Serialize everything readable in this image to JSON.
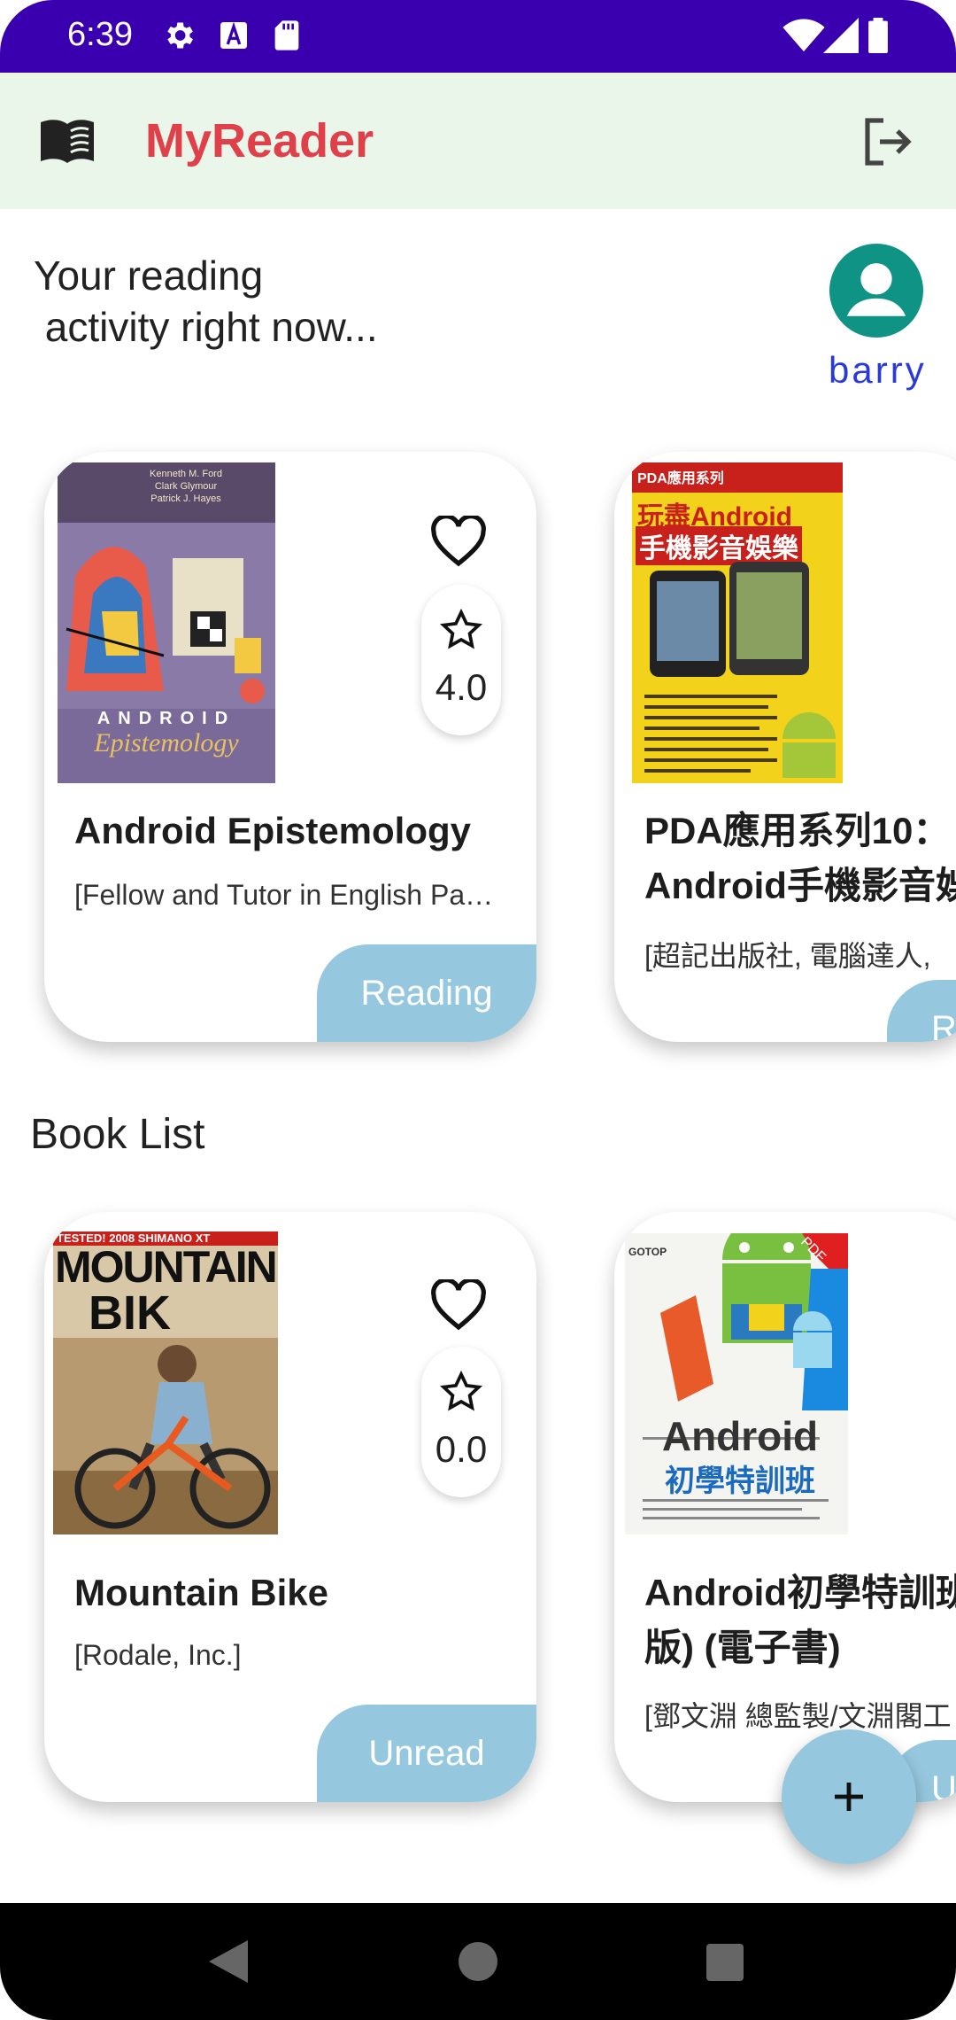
{
  "status_bar": {
    "time": "6:39"
  },
  "app_bar": {
    "title": "MyReader"
  },
  "header": {
    "headline": "Your reading\n activity right now...",
    "username": "barry"
  },
  "reading_cards": [
    {
      "title": "Android Epistemology",
      "publisher": "[Fellow and Tutor in English Pa…",
      "rating": "4.0",
      "status": "Reading",
      "cover": {
        "authors": "Kenneth M. Ford\nClark Glymour\nPatrick J. Hayes",
        "wordmark": "ANDROID",
        "subtitle": "Epistemology"
      }
    },
    {
      "title": "PDA應用系列10：\nAndroid手機影音娛",
      "publisher": "[超記出版社, 電腦達人,",
      "status": "R",
      "cover": {
        "series": "PDA應用系列",
        "line1": "玩盡Android",
        "line2": "手機影音娛樂"
      }
    }
  ],
  "book_list": {
    "title": "Book List",
    "cards": [
      {
        "title": "Mountain Bike",
        "publisher": "[Rodale, Inc.]",
        "rating": "0.0",
        "status": "Unread",
        "cover": {
          "banner": "TESTED! 2008 SHIMANO XT",
          "line1": "MOUNTAIN",
          "line2": "BIK"
        }
      },
      {
        "title": "Android初學特訓班\n版) (電子書)",
        "publisher": "[鄧文淵 總監製/文淵閣工",
        "status": "U",
        "cover": {
          "brand": "GOTOP",
          "badge": "PDF",
          "line1": "Android",
          "line2": "初學特訓班"
        }
      }
    ]
  },
  "colors": {
    "status_bar": "#3a00b0",
    "app_bar": "#e9f6e9",
    "title": "#e0404a",
    "accent": "#95c8df",
    "avatar": "#0f9384",
    "username": "#2a3ad6"
  },
  "icons": [
    "settings-icon",
    "a-letter-icon",
    "sd-card-icon",
    "wifi-icon",
    "signal-icon",
    "battery-icon",
    "book-icon",
    "logout-icon",
    "account-icon",
    "heart-icon",
    "star-icon",
    "plus-icon",
    "back-icon",
    "home-icon",
    "recents-icon"
  ]
}
